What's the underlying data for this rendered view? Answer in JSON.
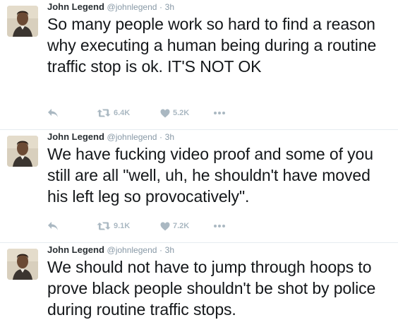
{
  "tweets": [
    {
      "name": "John Legend",
      "handle": "@johnlegend",
      "separator": "·",
      "time": "3h",
      "text": "So many people work so hard to find a reason why executing a human being during a routine traffic stop is ok. IT'S NOT OK",
      "retweets": "6.4K",
      "likes": "5.2K"
    },
    {
      "name": "John Legend",
      "handle": "@johnlegend",
      "separator": "·",
      "time": "3h",
      "text": "We have fucking video proof and some of you still are all \"well, uh, he shouldn't have moved his left leg so provocatively\".",
      "retweets": "9.1K",
      "likes": "7.2K"
    },
    {
      "name": "John Legend",
      "handle": "@johnlegend",
      "separator": "·",
      "time": "3h",
      "text": "We should not have to jump through hoops to prove black people shouldn't be shot by police during routine traffic stops."
    }
  ],
  "icons": {
    "reply": "reply-icon",
    "retweet": "retweet-icon",
    "like": "heart-icon",
    "more": "more-icon"
  },
  "colors": {
    "text": "#14171a",
    "meta": "#8899a6",
    "action": "#aab8c2",
    "divider": "#e6ecf0"
  }
}
